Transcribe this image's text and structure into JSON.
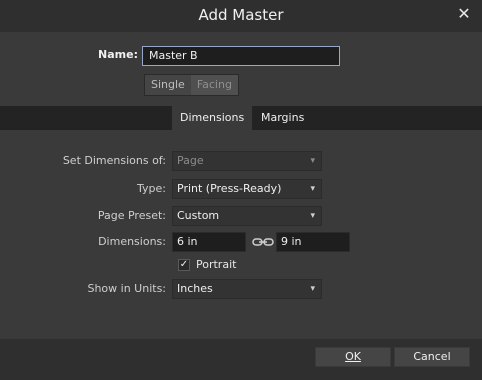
{
  "window": {
    "title": "Add Master",
    "close_label": "✕"
  },
  "name": {
    "label": "Name:",
    "value": "Master B"
  },
  "page_mode": {
    "options": [
      "Single",
      "Facing"
    ],
    "selected": "Single"
  },
  "tabs": [
    {
      "label": "Dimensions",
      "active": true
    },
    {
      "label": "Margins",
      "active": false
    }
  ],
  "form": {
    "set_dimensions_of": {
      "label": "Set Dimensions of:",
      "value": "Page",
      "disabled": true
    },
    "type": {
      "label": "Type:",
      "value": "Print (Press-Ready)"
    },
    "page_preset": {
      "label": "Page Preset:",
      "value": "Custom"
    },
    "dimensions": {
      "label": "Dimensions:",
      "width": "6 in",
      "height": "9 in"
    },
    "portrait": {
      "label": "Portrait",
      "checked": true
    },
    "show_in_units": {
      "label": "Show in Units:",
      "value": "Inches"
    }
  },
  "buttons": {
    "ok": "OK",
    "cancel": "Cancel"
  }
}
